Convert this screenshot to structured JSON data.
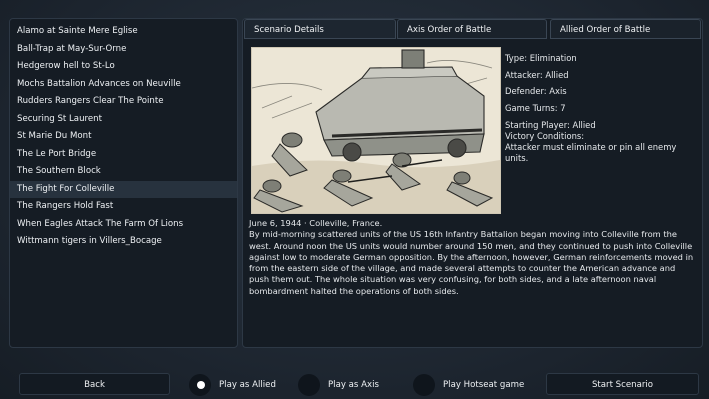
{
  "scenarios": [
    "Alamo at Sainte Mere Eglise",
    "Ball-Trap at May-Sur-Orne",
    "Hedgerow hell to St-Lo",
    "Mochs Battalion Advances on Neuville",
    "Rudders Rangers Clear The Pointe",
    "Securing St Laurent",
    "St Marie Du Mont",
    "The Le Port Bridge",
    "The Southern Block",
    "The Fight For Colleville",
    "The Rangers Hold Fast",
    "When Eagles Attack The Farm Of Lions",
    "Wittmann tigers in Villers_Bocage"
  ],
  "selected_index": 9,
  "tabs": {
    "details": "Scenario Details",
    "axis": "Axis Order of Battle",
    "allied": "Allied Order of Battle"
  },
  "details": {
    "type": "Type: Elimination",
    "attacker": "Attacker: Allied",
    "defender": "Defender: Axis",
    "turns": "Game Turns: 7",
    "starting": "Starting Player: Allied",
    "victory_label": "Victory Conditions:",
    "victory_text": "Attacker must eliminate or pin all enemy units."
  },
  "description": {
    "dateline": "June 6, 1944  ·  Colleville, France.",
    "body": "By mid-morning scattered units of the US 16th Infantry Battalion began moving into Colleville from the west. Around noon the US units would number around 150 men, and they continued to push into Colleville against low to moderate German opposition. By the afternoon, however, German reinforcements moved in from the eastern side of the village, and made several attempts to counter the American advance and push them out. The whole situation was very confusing, for both sides, and a late afternoon naval bombardment halted the operations of both sides."
  },
  "bottom": {
    "back": "Back",
    "play_allied": "Play as Allied",
    "play_axis": "Play as Axis",
    "play_hotseat": "Play Hotseat game",
    "start": "Start Scenario"
  }
}
